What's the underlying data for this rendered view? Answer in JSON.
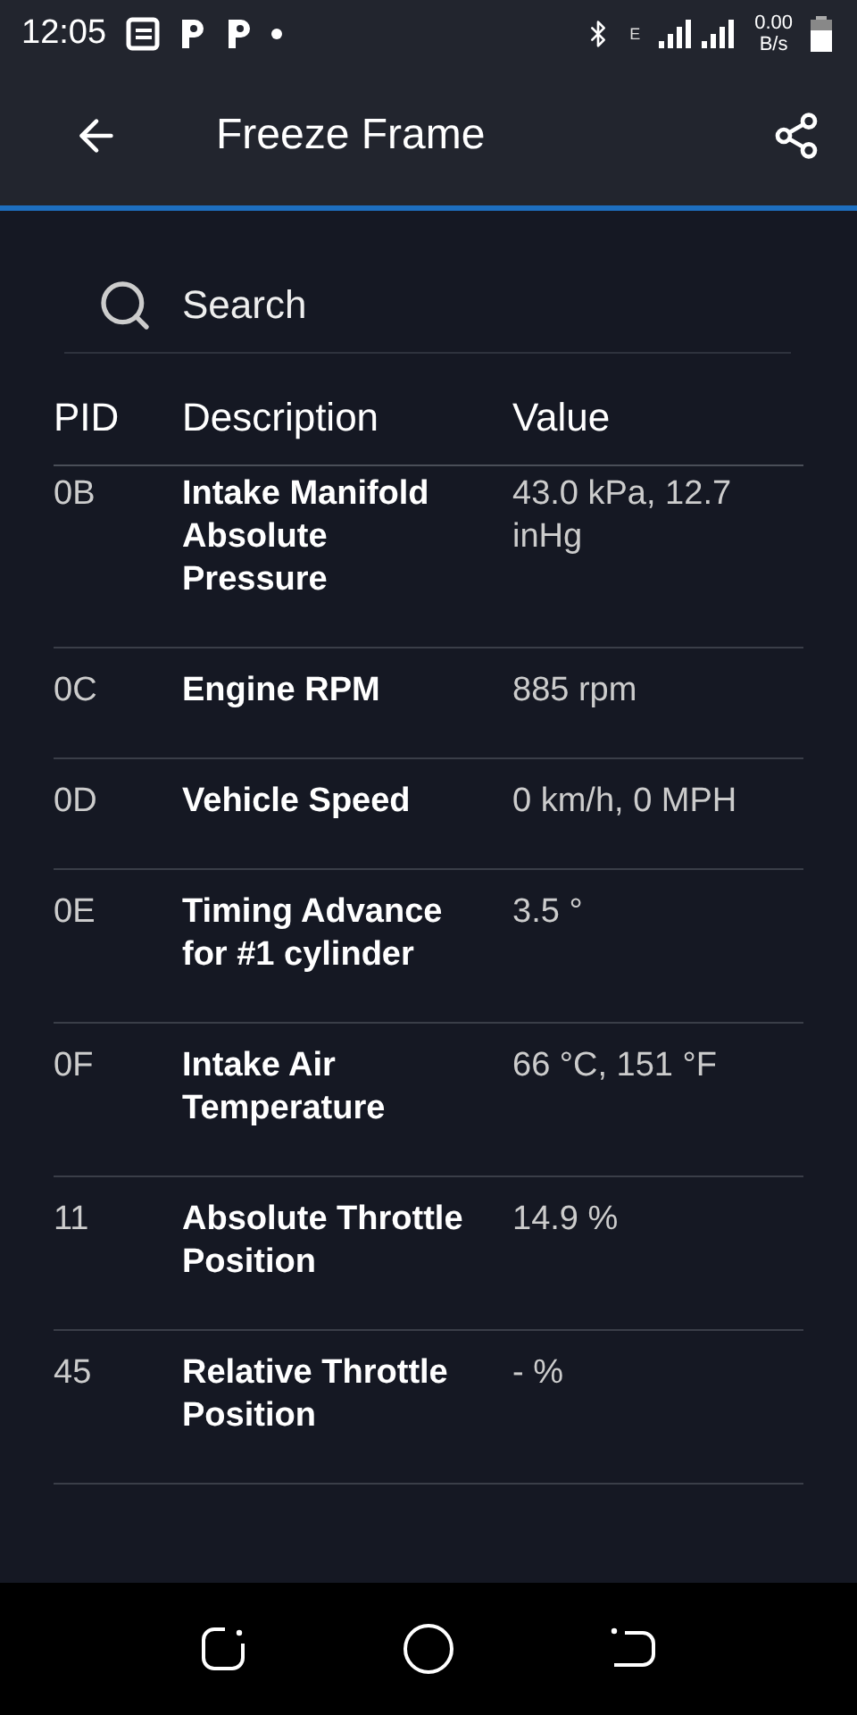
{
  "status_bar": {
    "time": "12:05",
    "network_type": "E",
    "speed_value": "0.00",
    "speed_unit": "B/s"
  },
  "app_bar": {
    "title": "Freeze Frame"
  },
  "search": {
    "placeholder": "Search"
  },
  "table": {
    "columns": [
      "PID",
      "Description",
      "Value"
    ],
    "rows": [
      {
        "pid": "0B",
        "description": "Intake Manifold Absolute Pressure",
        "value": "43.0 kPa, 12.7 inHg"
      },
      {
        "pid": "0C",
        "description": "Engine RPM",
        "value": "885 rpm"
      },
      {
        "pid": "0D",
        "description": "Vehicle Speed",
        "value": "0 km/h, 0 MPH"
      },
      {
        "pid": "0E",
        "description": "Timing Advance for #1 cylinder",
        "value": "3.5 °"
      },
      {
        "pid": "0F",
        "description": "Intake Air Temperature",
        "value": "66 °C, 151 °F"
      },
      {
        "pid": "11",
        "description": "Absolute Throttle Position",
        "value": "14.9 %"
      },
      {
        "pid": "45",
        "description": "Relative Throttle Position",
        "value": "- %"
      }
    ]
  }
}
